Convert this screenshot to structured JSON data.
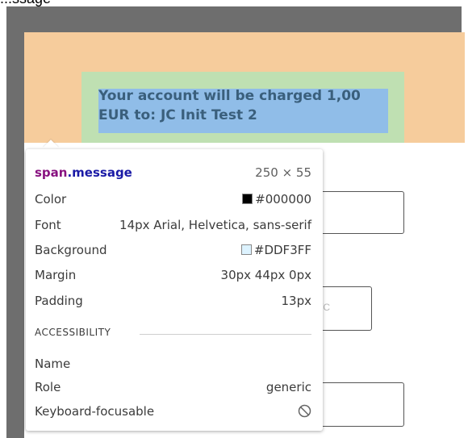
{
  "page_label": "...ssage",
  "message": {
    "text": "Your account will be charged 1,00 EUR to: JC Init Test 2"
  },
  "form": {
    "field2_hint": "/C"
  },
  "inspector": {
    "selector_tag": "span",
    "selector_class": ".message",
    "dimensions": "250 × 55",
    "rows": [
      {
        "label": "Color",
        "value": "#000000"
      },
      {
        "label": "Font",
        "value": "14px Arial, Helvetica, sans-serif"
      },
      {
        "label": "Background",
        "value": "#DDF3FF"
      },
      {
        "label": "Margin",
        "value": "30px 44px 0px"
      },
      {
        "label": "Padding",
        "value": "13px"
      }
    ],
    "accessibility_title": "ACCESSIBILITY",
    "accessibility_rows": [
      {
        "label": "Name",
        "value": ""
      },
      {
        "label": "Role",
        "value": "generic"
      },
      {
        "label": "Keyboard-focusable",
        "value": ""
      }
    ]
  },
  "colors": {
    "swatch_color": "#000000",
    "swatch_background": "#DDF3FF",
    "margin_overlay": "#f6cc9c",
    "padding_overlay": "#bfe0b2",
    "content_overlay": "#90bde8"
  },
  "icons": {
    "keyboard_focusable": "blocked-circle-icon"
  }
}
